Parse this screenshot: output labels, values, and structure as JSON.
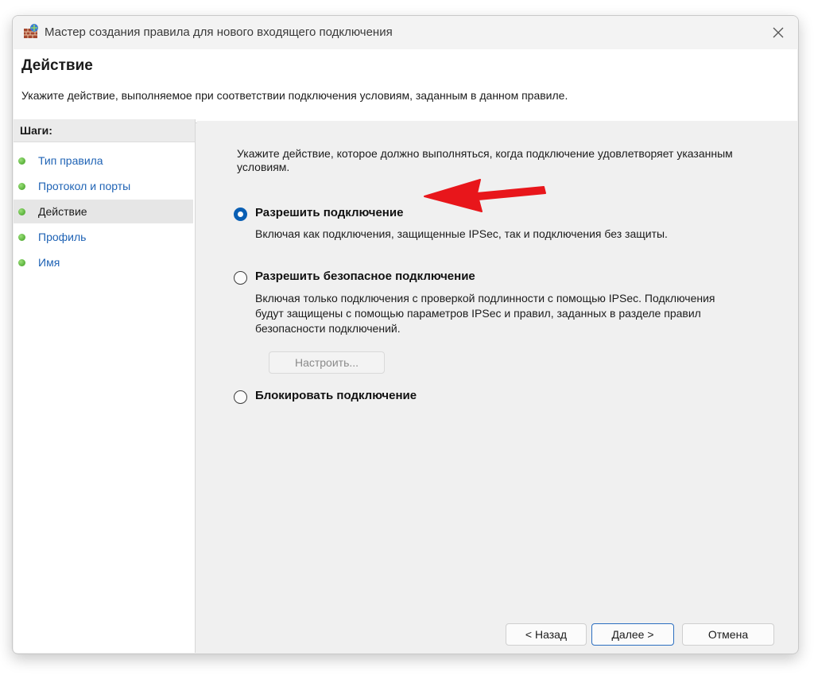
{
  "window": {
    "title": "Мастер создания правила для нового входящего подключения"
  },
  "header": {
    "title": "Действие",
    "subtitle": "Укажите действие, выполняемое при соответствии подключения условиям, заданным в данном правиле."
  },
  "steps": {
    "header": "Шаги:",
    "items": [
      {
        "label": "Тип правила"
      },
      {
        "label": "Протокол и порты"
      },
      {
        "label": "Действие"
      },
      {
        "label": "Профиль"
      },
      {
        "label": "Имя"
      }
    ]
  },
  "content": {
    "intro": "Укажите действие, которое должно выполняться, когда подключение удовлетворяет указанным условиям.",
    "options": [
      {
        "label": "Разрешить подключение",
        "description": "Включая как подключения, защищенные IPSec, так и подключения без защиты."
      },
      {
        "label": "Разрешить безопасное подключение",
        "description": "Включая только подключения с проверкой подлинности с помощью IPSec. Подключения будут защищены с помощью параметров IPSec и правил, заданных в разделе правил безопасности подключений."
      },
      {
        "label": "Блокировать подключение",
        "description": ""
      }
    ],
    "customize_label": "Настроить..."
  },
  "footer": {
    "back_label": "< Назад",
    "next_label": "Далее >",
    "cancel_label": "Отмена"
  },
  "colors": {
    "accent": "#0a5fb4",
    "link": "#1f63b5",
    "annotation_arrow": "#e8161b",
    "step_dot": "#3b9b1d"
  }
}
